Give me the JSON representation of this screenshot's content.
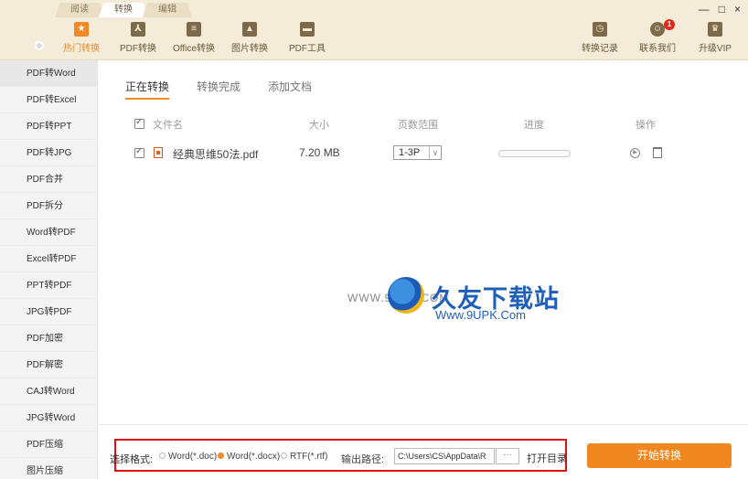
{
  "mode_tabs": [
    "阅读",
    "转换",
    "编辑"
  ],
  "toolbar": {
    "tools": [
      "热门转换",
      "PDF转换",
      "Office转换",
      "图片转换",
      "PDF工具"
    ],
    "right_tools": [
      "转换记录",
      "联系我们",
      "升级VIP"
    ],
    "notification_count": "1"
  },
  "window_controls": {
    "minimize": "—",
    "maximize": "□",
    "close": "×"
  },
  "sidebar": {
    "items": [
      "PDF转Word",
      "PDF转Excel",
      "PDF转PPT",
      "PDF转JPG",
      "PDF合并",
      "PDF拆分",
      "Word转PDF",
      "Excel转PDF",
      "PPT转PDF",
      "JPG转PDF",
      "PDF加密",
      "PDF解密",
      "CAJ转Word",
      "JPG转Word",
      "PDF压缩",
      "图片压缩"
    ]
  },
  "tabs": [
    "正在转换",
    "转换完成",
    "添加文档"
  ],
  "table": {
    "headers": {
      "name": "文件名",
      "size": "大小",
      "pages": "页数范围",
      "progress": "进度",
      "ops": "操作"
    },
    "row": {
      "name": "经典思维50法.pdf",
      "size": "7.20 MB",
      "pages": "1-3P",
      "progress": 0
    }
  },
  "watermark": {
    "small": "WWW.9UPK.COM",
    "big": "久友下载站",
    "url": "Www.9UPK.Com"
  },
  "bottom": {
    "format_label": "选择格式:",
    "formats": [
      "Word(*.doc)",
      "Word(*.docx)",
      "RTF(*.rtf)"
    ],
    "selected_format": 1,
    "path_label": "输出路径:",
    "path_value": "C:\\Users\\CS\\AppData\\R",
    "dots": "···",
    "open_dir": "打开目录",
    "start": "开始转换"
  },
  "colors": {
    "accent": "#f08a28",
    "highlight_box": "#e01010"
  }
}
